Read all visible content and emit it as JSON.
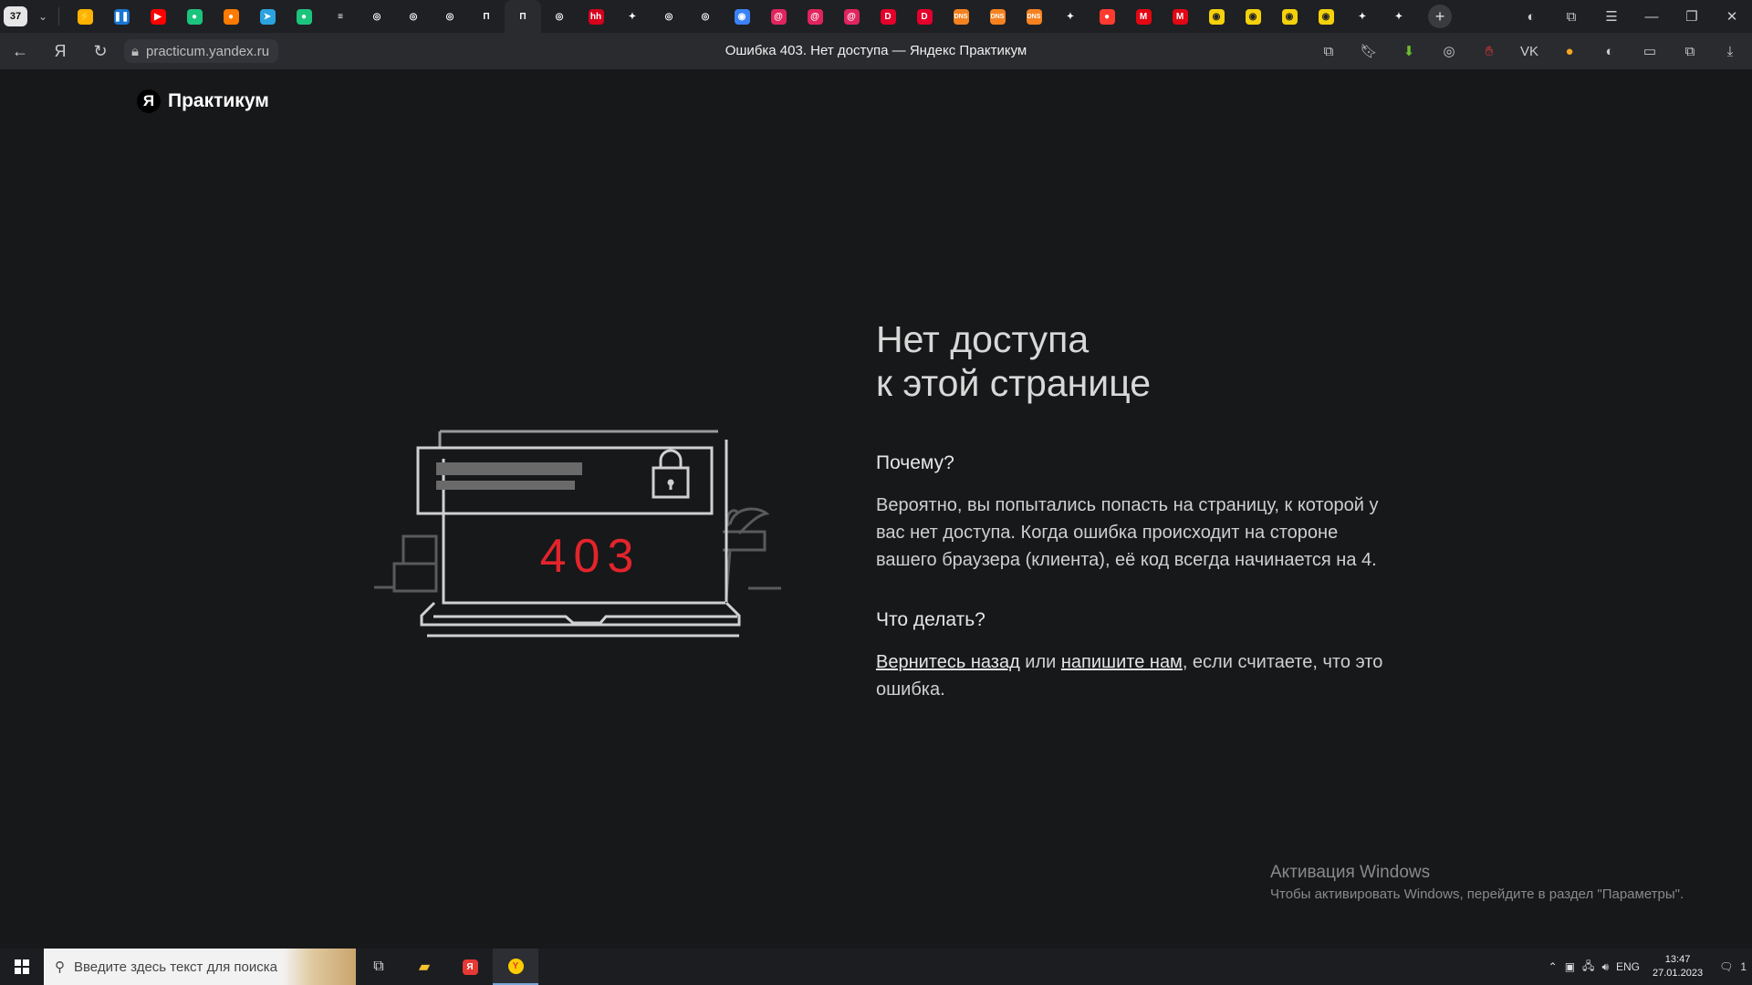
{
  "browser": {
    "tab_count": "37",
    "tabs": [
      {
        "icon": "lightning-icon",
        "color": "#ffb300",
        "glyph": "⚡"
      },
      {
        "icon": "pause-icon",
        "color": "#1976d2",
        "glyph": "❚❚"
      },
      {
        "icon": "youtube-icon",
        "color": "#ff0000",
        "glyph": "▶"
      },
      {
        "icon": "figma-icon",
        "color": "#1bc47d",
        "glyph": "●"
      },
      {
        "icon": "circle-icon",
        "color": "#ff7a00",
        "glyph": "●"
      },
      {
        "icon": "telegram-icon",
        "color": "#2aa3e0",
        "glyph": "➤"
      },
      {
        "icon": "figma-icon",
        "color": "#1bc47d",
        "glyph": "●"
      },
      {
        "icon": "layers-icon",
        "color": "#ffffff",
        "glyph": "≡"
      },
      {
        "icon": "github-icon",
        "color": "#ffffff",
        "glyph": "◎"
      },
      {
        "icon": "github-icon",
        "color": "#ffffff",
        "glyph": "◎"
      },
      {
        "icon": "github-icon",
        "color": "#ffffff",
        "glyph": "◎"
      },
      {
        "icon": "notion-icon",
        "color": "#ffffff",
        "glyph": "П"
      },
      {
        "icon": "notion-icon",
        "color": "#ffffff",
        "glyph": "П",
        "active": true
      },
      {
        "icon": "github-icon",
        "color": "#ffffff",
        "glyph": "◎"
      },
      {
        "icon": "hh-icon",
        "color": "#d6001c",
        "glyph": "hh"
      },
      {
        "icon": "sparkle-icon",
        "color": "#ffffff",
        "glyph": "✦"
      },
      {
        "icon": "github-icon",
        "color": "#ffffff",
        "glyph": "◎"
      },
      {
        "icon": "github-icon",
        "color": "#ffffff",
        "glyph": "◎"
      },
      {
        "icon": "compass-icon",
        "color": "#3b82f6",
        "glyph": "◉"
      },
      {
        "icon": "spiral-icon",
        "color": "#e0245e",
        "glyph": "@"
      },
      {
        "icon": "spiral-icon",
        "color": "#e0245e",
        "glyph": "@"
      },
      {
        "icon": "spiral-icon",
        "color": "#e0245e",
        "glyph": "@"
      },
      {
        "icon": "d-icon",
        "color": "#e3002b",
        "glyph": "D"
      },
      {
        "icon": "d-icon",
        "color": "#e3002b",
        "glyph": "D"
      },
      {
        "icon": "dns-icon",
        "color": "#f58220",
        "glyph": "DNS"
      },
      {
        "icon": "dns-icon",
        "color": "#f58220",
        "glyph": "DNS"
      },
      {
        "icon": "dns-icon",
        "color": "#f58220",
        "glyph": "DNS"
      },
      {
        "icon": "sparkle-icon",
        "color": "#ffffff",
        "glyph": "✦"
      },
      {
        "icon": "map-pin-icon",
        "color": "#ff3b30",
        "glyph": "●"
      },
      {
        "icon": "m-icon",
        "color": "#e30613",
        "glyph": "M"
      },
      {
        "icon": "m-icon",
        "color": "#e30613",
        "glyph": "M"
      },
      {
        "icon": "smile-icon",
        "color": "#f5d10c",
        "glyph": "◉"
      },
      {
        "icon": "smile-icon",
        "color": "#f5d10c",
        "glyph": "◉"
      },
      {
        "icon": "smile-icon",
        "color": "#f5d10c",
        "glyph": "◉"
      },
      {
        "icon": "smile-icon",
        "color": "#f5d10c",
        "glyph": "◉"
      },
      {
        "icon": "sparkle-icon",
        "color": "#ffffff",
        "glyph": "✦"
      },
      {
        "icon": "sparkle-icon",
        "color": "#ffffff",
        "glyph": "✦"
      }
    ],
    "url": "practicum.yandex.ru",
    "page_title": "Ошибка 403. Нет доступа — Яндекс Практикум"
  },
  "page": {
    "brand_logo": "Я",
    "brand_name": "Практикум",
    "illustration_code": "403",
    "heading_line1": "Нет доступа",
    "heading_line2": "к этой странице",
    "why_title": "Почему?",
    "why_text": "Вероятно, вы попытались попасть на страницу, к которой у вас нет доступа. Когда ошибка происходит на стороне вашего браузера (клиента), её код всегда начинается на 4.",
    "what_title": "Что делать?",
    "action_link_back": "Вернитесь назад",
    "action_or": " или ",
    "action_link_write": "напишите нам",
    "action_tail": ", если считаете, что это ошибка.",
    "accent_color": "#e3242b"
  },
  "activation": {
    "title": "Активация Windows",
    "subtitle": "Чтобы активировать Windows, перейдите в раздел \"Параметры\"."
  },
  "taskbar": {
    "search_placeholder": "Введите здесь текст для поиска",
    "lang": "ENG",
    "time": "13:47",
    "date": "27.01.2023",
    "notifications": "1"
  }
}
